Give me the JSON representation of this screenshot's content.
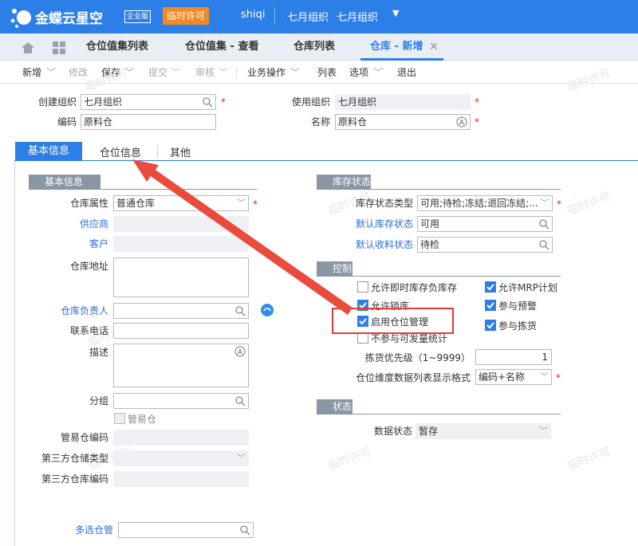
{
  "header": {
    "logo_text": "金蝶云星空",
    "edition_badge": "企业版",
    "license_button": "临时许可",
    "user": "shiqi",
    "org_1": "七月组织",
    "org_2": "七月组织"
  },
  "tabs": [
    {
      "label": "仓位值集列表"
    },
    {
      "label": "仓位值集 - 查看"
    },
    {
      "label": "仓库列表"
    },
    {
      "label": "仓库 - 新增"
    }
  ],
  "toolbar": {
    "new": "新增",
    "modify": "修改",
    "save": "保存",
    "submit": "提交",
    "audit": "审核",
    "business": "业务操作",
    "list": "列表",
    "options": "选项",
    "exit": "退出"
  },
  "watermark": "临时许可",
  "form_top": {
    "create_org_label": "创建组织",
    "create_org_value": "七月组织",
    "use_org_label": "使用组织",
    "use_org_value": "七月组织",
    "code_label": "编码",
    "code_value": "原料仓",
    "name_label": "名称",
    "name_value": "原料仓"
  },
  "subtabs": {
    "basic": "基本信息",
    "location": "仓位信息",
    "other": "其他"
  },
  "basic": {
    "section_title": "基本信息",
    "warehouse_attr_label": "仓库属性",
    "warehouse_attr_value": "普通仓库",
    "supplier_label": "供应商",
    "customer_label": "客户",
    "address_label": "仓库地址",
    "manager_label": "仓库负责人",
    "phone_label": "联系电话",
    "desc_label": "描述",
    "group_label": "分组",
    "managed_label": "管易仓",
    "managed_code_label": "管易仓编码",
    "third_type_label": "第三方仓储类型",
    "third_code_label": "第三方仓库编码",
    "multi_label": "多选仓管"
  },
  "inventory": {
    "section_title": "库存状态",
    "type_label": "库存状态类型",
    "type_value": "可用;待检;冻结;退回冻结;...",
    "default_label": "默认库存状态",
    "default_value": "可用",
    "receive_label": "默认收料状态",
    "receive_value": "待检"
  },
  "control": {
    "section_title": "控制",
    "allow_negative": "允许即时库存负库存",
    "allow_mrp": "允许MRP计划",
    "allow_lock": "允许锁库",
    "join_alert": "参与预警",
    "enable_location": "启用仓位管理",
    "join_picking": "参与拣货",
    "no_send": "不参与可发量统计",
    "priority_label": "拣货优先级（1~9999）",
    "priority_value": "1",
    "dim_label": "仓位维度数据列表显示格式",
    "dim_value": "编码+名称"
  },
  "status": {
    "section_title": "状态",
    "data_label": "数据状态",
    "data_value": "暂存"
  },
  "colors": {
    "primary": "#2d7fe8",
    "license": "#f08a24",
    "arrow": "#e94c3d",
    "highlight": "#e53935"
  }
}
